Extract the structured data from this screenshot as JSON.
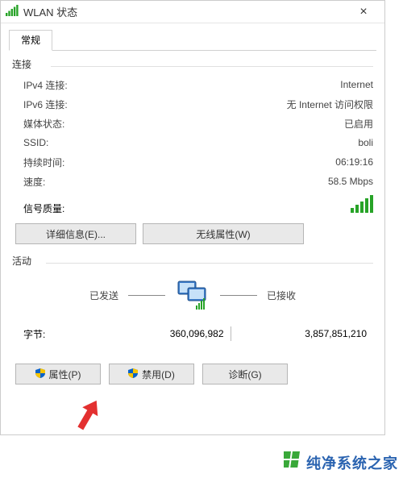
{
  "window": {
    "title": "WLAN 状态",
    "close": "×"
  },
  "tabs": {
    "general": "常规"
  },
  "connection": {
    "header": "连接",
    "ipv4_k": "IPv4 连接:",
    "ipv4_v": "Internet",
    "ipv6_k": "IPv6 连接:",
    "ipv6_v": "无 Internet 访问权限",
    "media_k": "媒体状态:",
    "media_v": "已启用",
    "ssid_k": "SSID:",
    "ssid_v": "boli",
    "dur_k": "持续时间:",
    "dur_v": "06:19:16",
    "speed_k": "速度:",
    "speed_v": "58.5 Mbps",
    "sig_k": "信号质量:"
  },
  "buttons": {
    "details": "详细信息(E)...",
    "wireless_props": "无线属性(W)",
    "properties": "属性(P)",
    "disable": "禁用(D)",
    "diagnose": "诊断(G)"
  },
  "activity": {
    "header": "活动",
    "sent": "已发送",
    "received": "已接收",
    "bytes_k": "字节:",
    "bytes_sent": "360,096,982",
    "bytes_recv": "3,857,851,210"
  },
  "watermark": "纯净系统之家"
}
